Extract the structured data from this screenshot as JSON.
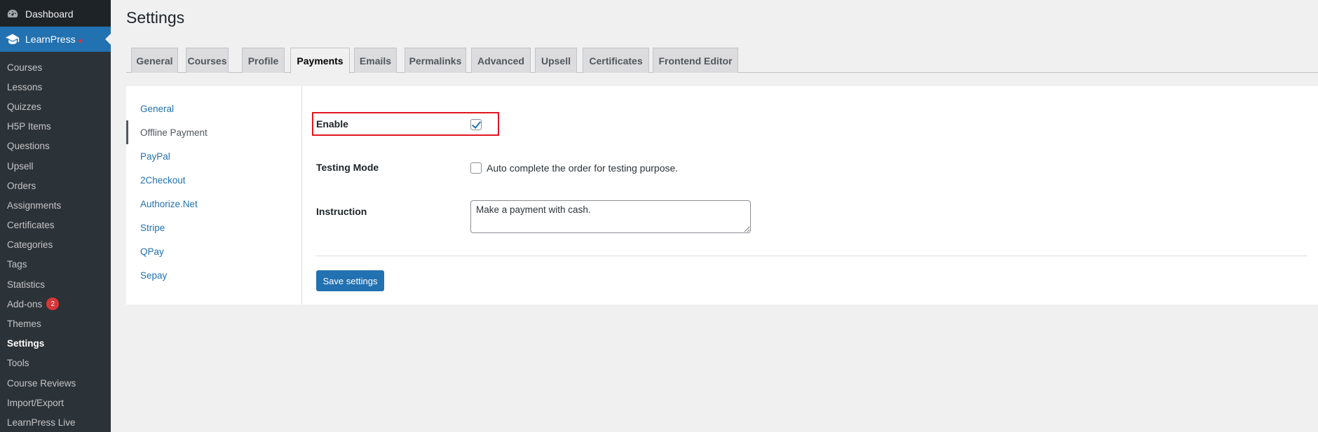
{
  "sidebar": {
    "dashboard": {
      "label": "Dashboard",
      "icon": "dashboard-icon"
    },
    "learnpress": {
      "label": "LearnPress",
      "icon": "graduation-cap-icon"
    },
    "items": [
      {
        "label": "Courses"
      },
      {
        "label": "Lessons"
      },
      {
        "label": "Quizzes"
      },
      {
        "label": "H5P Items"
      },
      {
        "label": "Questions"
      },
      {
        "label": "Upsell"
      },
      {
        "label": "Orders"
      },
      {
        "label": "Assignments"
      },
      {
        "label": "Certificates"
      },
      {
        "label": "Categories"
      },
      {
        "label": "Tags"
      },
      {
        "label": "Statistics"
      },
      {
        "label": "Add-ons",
        "badge": "2"
      },
      {
        "label": "Themes"
      },
      {
        "label": "Settings"
      },
      {
        "label": "Tools"
      },
      {
        "label": "Course Reviews"
      },
      {
        "label": "Import/Export"
      },
      {
        "label": "LearnPress Live"
      }
    ]
  },
  "page": {
    "title": "Settings"
  },
  "tabs": [
    "General",
    "Courses",
    "Profile",
    "Payments",
    "Emails",
    "Permalinks",
    "Advanced",
    "Upsell",
    "Certificates",
    "Frontend Editor"
  ],
  "payment_nav": [
    "General",
    "Offline Payment",
    "PayPal",
    "2Checkout",
    "Authorize.Net",
    "Stripe",
    "QPay",
    "Sepay"
  ],
  "form": {
    "enable_label": "Enable",
    "enable_checked": true,
    "testing_label": "Testing Mode",
    "testing_checked": false,
    "testing_desc": "Auto complete the order for testing purpose.",
    "instruction_label": "Instruction",
    "instruction_value": "Make a payment with cash.",
    "save_label": "Save settings"
  },
  "colors": {
    "accent": "#2271b1",
    "sidebar_bg": "#1d2327",
    "highlight": "#e0161d",
    "badge": "#d63638"
  }
}
